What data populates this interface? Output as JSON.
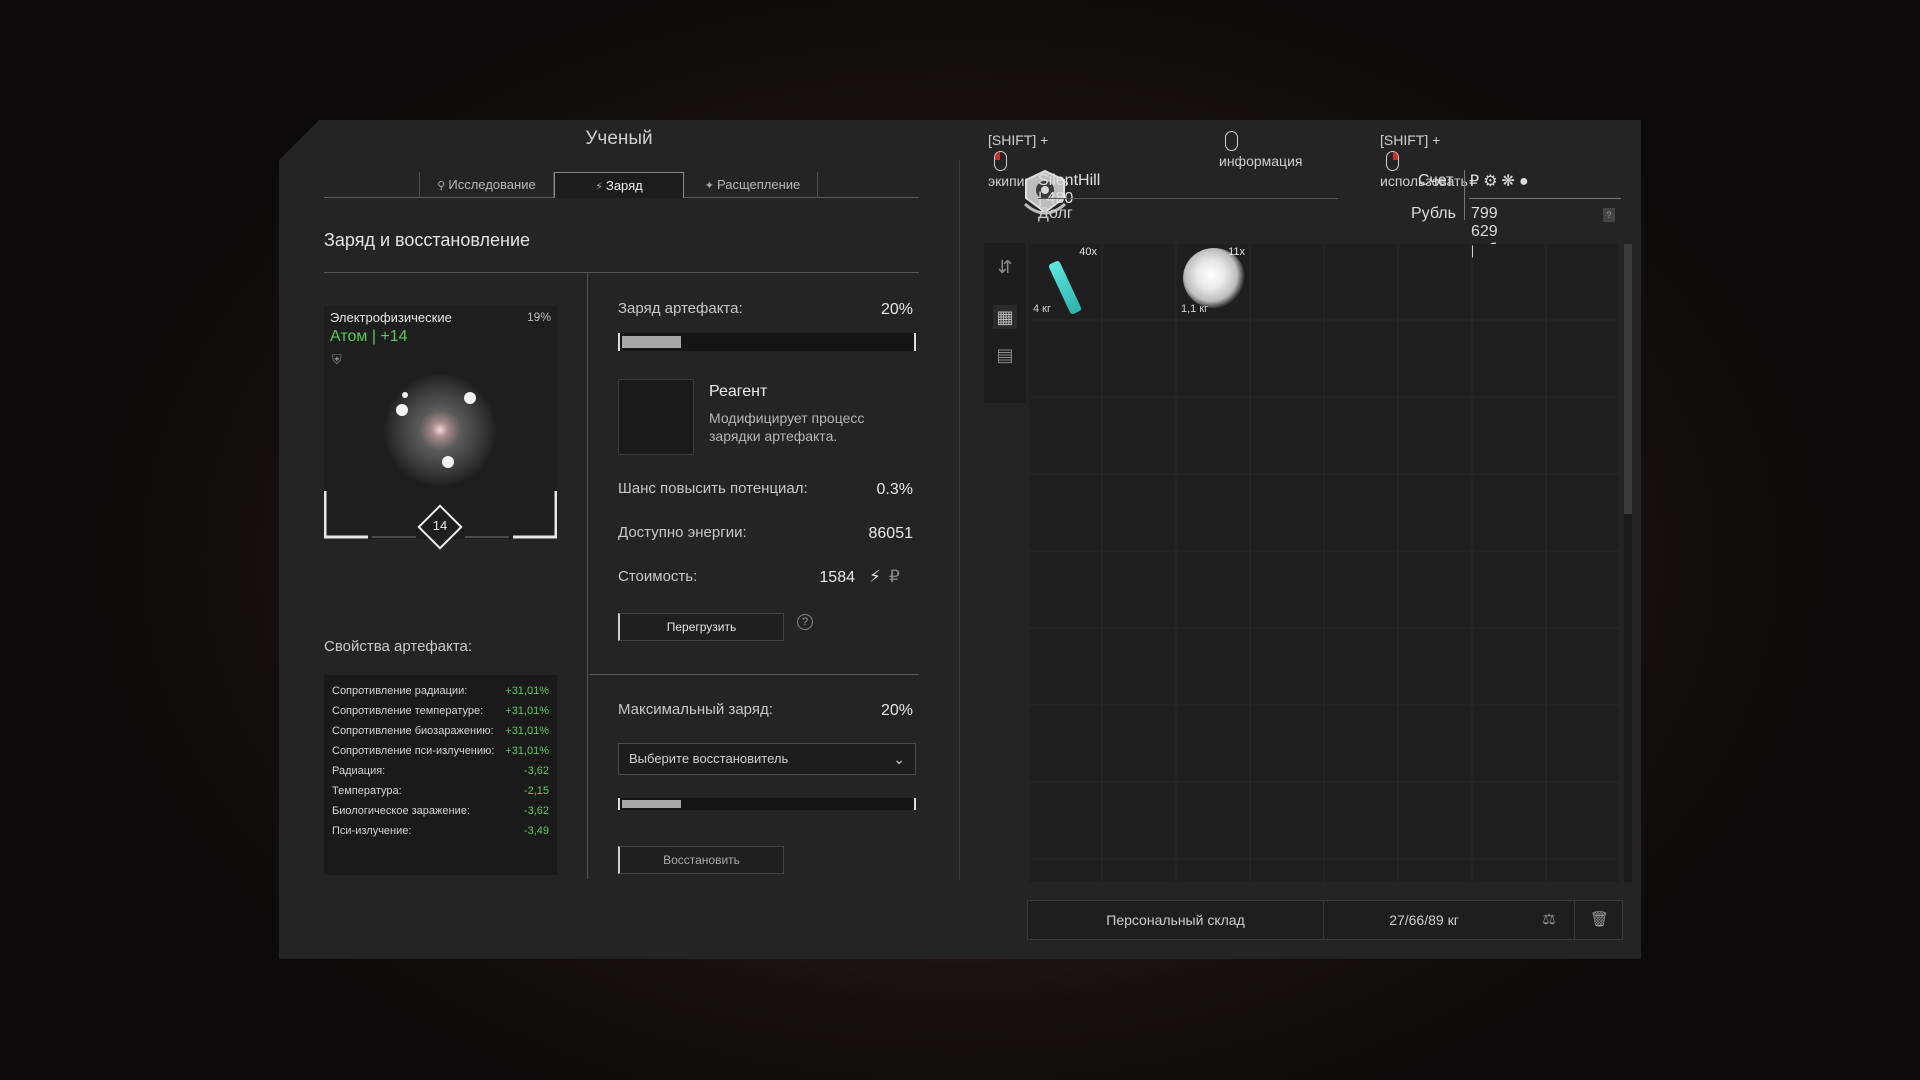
{
  "left": {
    "title": "Ученый",
    "tabs": [
      {
        "label": ""
      },
      {
        "label": "Исследование",
        "icon": "magnifier-icon"
      },
      {
        "label": "Заряд",
        "icon": "lightning-icon"
      },
      {
        "label": "Расщепление",
        "icon": "split-icon"
      },
      {
        "label": ""
      }
    ],
    "section_title": "Заряд и восстановление",
    "artifact": {
      "category": "Электрофизические",
      "percent": "19%",
      "name": "Атом | +14",
      "level": "14"
    },
    "props_title": "Свойства артефакта:",
    "props": [
      {
        "name": "Сопротивление радиации:",
        "value": "+31,01%"
      },
      {
        "name": "Сопротивление температуре:",
        "value": "+31,01%"
      },
      {
        "name": "Сопротивление биозаражению:",
        "value": "+31,01%"
      },
      {
        "name": "Сопротивление пси-излучению:",
        "value": "+31,01%"
      },
      {
        "name": "Радиация:",
        "value": "-3,62"
      },
      {
        "name": "Температура:",
        "value": "-2,15"
      },
      {
        "name": "Биологическое заражение:",
        "value": "-3,62"
      },
      {
        "name": "Пси-излучение:",
        "value": "-3,49"
      }
    ],
    "charge": {
      "label": "Заряд артефакта:",
      "value": "20%",
      "level": 0.2
    },
    "reagent": {
      "title": "Реагент",
      "desc": "Модифицирует процесс зарядки артефакта."
    },
    "chance": {
      "label": "Шанс повысить потенциал:",
      "value": "0.3%"
    },
    "energy": {
      "label": "Доступно энергии:",
      "value": "86051"
    },
    "cost": {
      "label": "Стоимость:",
      "value": "1584"
    },
    "overload_button": "Перегрузить",
    "help": "?",
    "max_charge": {
      "label": "Максимальный заряд:",
      "value": "20%",
      "level": 0.2
    },
    "restorer_placeholder": "Выберите восстановитель",
    "restore_button": "Восстановить"
  },
  "right": {
    "hints": {
      "equip_key": "[SHIFT] +",
      "equip": "экипировать",
      "info": "информация",
      "use_key": "[SHIFT] +",
      "use": "использовать"
    },
    "user": "SilentHill | 480",
    "debt_label": "Долг",
    "account_label": "Счет",
    "currency_name": "Рубль",
    "money": "799 629 руб.",
    "items": [
      {
        "qty": "40x",
        "weight": "4 кг",
        "icon": "test-tube-icon",
        "color": "#4fd8d2"
      },
      {
        "qty": "11x",
        "weight": "1,1 кг",
        "icon": "white-cloud-icon"
      }
    ],
    "storage_label": "Персональный склад",
    "weight": "27/66/89 кг"
  },
  "colors": {
    "positive": "#5cc95c",
    "accent_red": "#c9302c"
  }
}
